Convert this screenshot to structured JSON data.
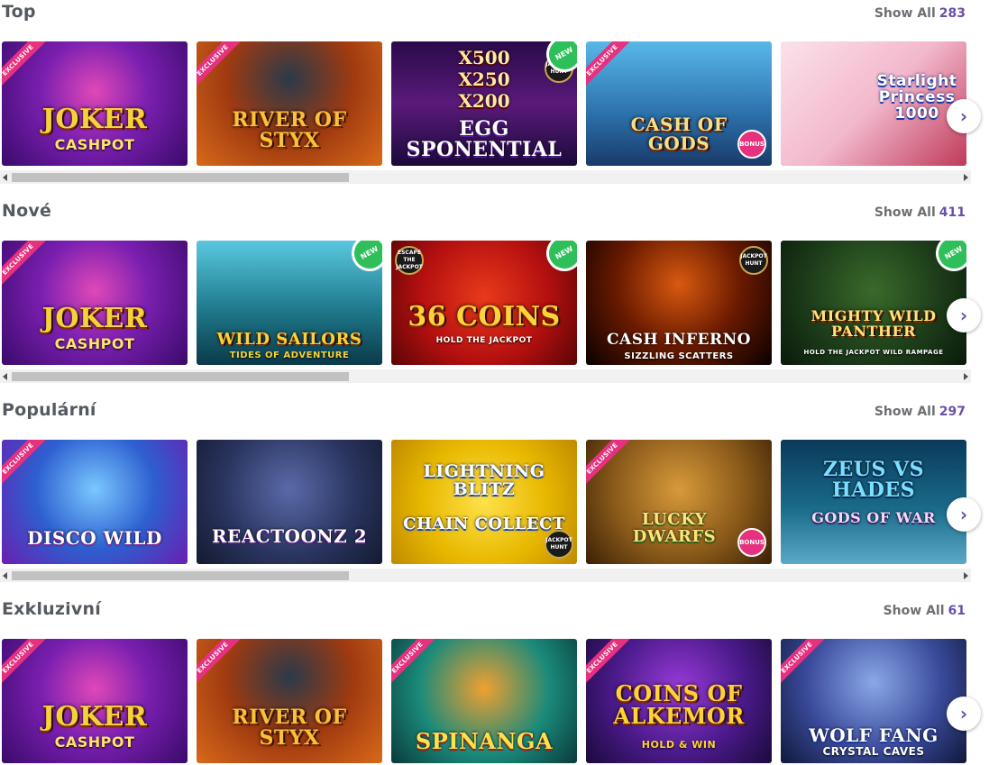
{
  "sections": [
    {
      "title": "Top",
      "show_all_label": "Show All",
      "count": "283",
      "games": [
        {
          "title": "JOKER",
          "sub": "CASHPOT",
          "ribbon": "EXCLUSIVE",
          "bg": "#6a1fa0"
        },
        {
          "title": "RIVER OF STYX",
          "sub": "",
          "ribbon": "EXCLUSIVE",
          "bg": "#b0401a"
        },
        {
          "title": "EGG SPONENTIAL",
          "sub": "",
          "multipliers": "X500 X250 X200",
          "new_badge": "NEW",
          "provider_badge": "JACKPOT HUNT",
          "bg": "#3a0f5c"
        },
        {
          "title": "CASH OF GODS",
          "sub": "",
          "ribbon": "EXCLUSIVE",
          "bonus_badge": "BONUS",
          "bg": "#2b6fa8"
        },
        {
          "title": "Starlight Princess 1000",
          "sub": "",
          "bg": "#f2c8d8"
        }
      ]
    },
    {
      "title": "Nové",
      "show_all_label": "Show All",
      "count": "411",
      "games": [
        {
          "title": "JOKER",
          "sub": "CASHPOT",
          "ribbon": "EXCLUSIVE",
          "bg": "#6a1fa0"
        },
        {
          "title": "WILD SAILORS",
          "sub": "TIDES OF ADVENTURE",
          "new_badge": "NEW",
          "bg": "#1f7a8c"
        },
        {
          "title": "36 COINS",
          "sub": "HOLD THE JACKPOT",
          "new_badge": "NEW",
          "provider_badge": "ESCAPE THE JACKPOT",
          "bg": "#b51010"
        },
        {
          "title": "CASH INFERNO",
          "sub": "SIZZLING SCATTERS",
          "provider_badge": "JACKPOT HUNT",
          "bg": "#2a0a00"
        },
        {
          "title": "MIGHTY WILD PANTHER",
          "sub": "HOLD THE JACKPOT WILD RAMPAGE",
          "new_badge": "NEW",
          "bg": "#1d3d1a"
        }
      ]
    },
    {
      "title": "Populární",
      "show_all_label": "Show All",
      "count": "297",
      "games": [
        {
          "title": "DISCO WILD",
          "sub": "",
          "ribbon": "EXCLUSIVE",
          "bg": "#2d5fd0"
        },
        {
          "title": "REACTOONZ 2",
          "sub": "",
          "bg": "#2a3560"
        },
        {
          "title": "LIGHTNING BLITZ",
          "sub": "CHAIN COLLECT",
          "provider_badge": "JACKPOT HUNT",
          "bg": "#e8b800"
        },
        {
          "title": "LUCKY DWARFS",
          "sub": "",
          "ribbon": "EXCLUSIVE",
          "bonus_badge": "BONUS",
          "bg": "#8a5a1a"
        },
        {
          "title": "ZEUS VS HADES",
          "sub": "GODS OF WAR",
          "bg": "#1a6a8a"
        }
      ]
    },
    {
      "title": "Exkluzivní",
      "show_all_label": "Show All",
      "count": "61",
      "games": [
        {
          "title": "JOKER",
          "sub": "CASHPOT",
          "ribbon": "EXCLUSIVE",
          "bg": "#6a1fa0"
        },
        {
          "title": "RIVER OF STYX",
          "sub": "",
          "ribbon": "EXCLUSIVE",
          "bg": "#b0401a"
        },
        {
          "title": "SPINANGA",
          "sub": "",
          "ribbon": "EXCLUSIVE",
          "bg": "#1a8a7a"
        },
        {
          "title": "COINS OF ALKEMOR",
          "sub": "HOLD & WIN",
          "ribbon": "EXCLUSIVE",
          "bg": "#4a1a8a"
        },
        {
          "title": "WOLF FANG",
          "sub": "CRYSTAL CAVES",
          "ribbon": "EXCLUSIVE",
          "bg": "#3a4a9a"
        }
      ]
    }
  ],
  "next_icon": "chevron-right-icon",
  "colors": {
    "accent": "#6b4fa8",
    "heading": "#555a60",
    "ribbon": "#e6317f",
    "new_badge": "#2fbf5a"
  }
}
